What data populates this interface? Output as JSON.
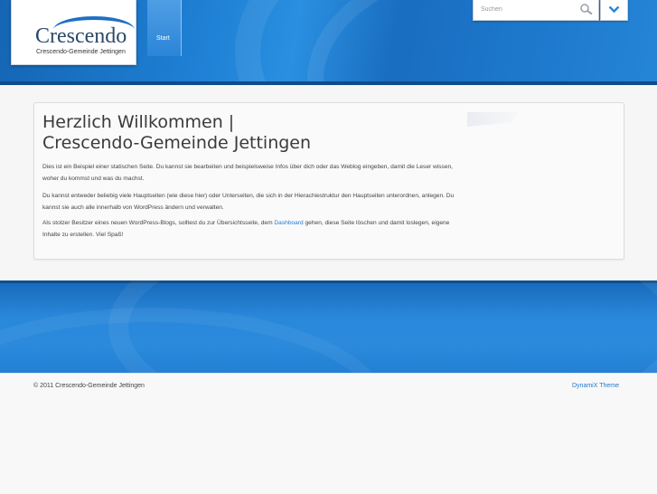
{
  "header": {
    "logo": {
      "name": "Crescendo",
      "tagline": "Crescendo-Gemeinde Jettingen"
    },
    "nav": [
      {
        "label": "Start"
      }
    ],
    "search": {
      "placeholder": "Suchen",
      "value": ""
    }
  },
  "main": {
    "title": "Herzlich Willkommen | Crescendo-Gemeinde Jettingen",
    "paragraphs": [
      "Dies ist ein Beispiel einer statischen Seite. Du kannst sie bearbeiten und beispielsweise Infos über dich oder das Weblog eingeben, damit die Leser wissen, woher du kommst und was du machst.",
      "Du kannst entweder beliebig viele Hauptseiten (wie diese hier) oder Unterseiten, die sich in der Hierachiestruktur den Hauptseiten unterordnen, anlegen. Du kannst sie auch alle innerhalb von WordPress ändern und verwalten."
    ],
    "paragraph3": {
      "before": "Als stolzer Besitzer eines neuen WordPress-Blogs, solltest du zur Übersichtsseite, dem ",
      "link": "Dashboard",
      "after": " gehen, diese Seite löschen und damit loslegen, eigene Inhalte zu erstellen. Viel Spaß!"
    }
  },
  "footer": {
    "copyright": "© 2011 Crescendo-Gemeinde Jettingen",
    "theme_link": "DynamiX Theme"
  },
  "colors": {
    "header_blue": "#1e7fd3",
    "link_blue": "#1f7ad0",
    "text": "#444444"
  },
  "icons": {
    "search": "search-icon",
    "dropdown": "chevron-down-icon"
  }
}
